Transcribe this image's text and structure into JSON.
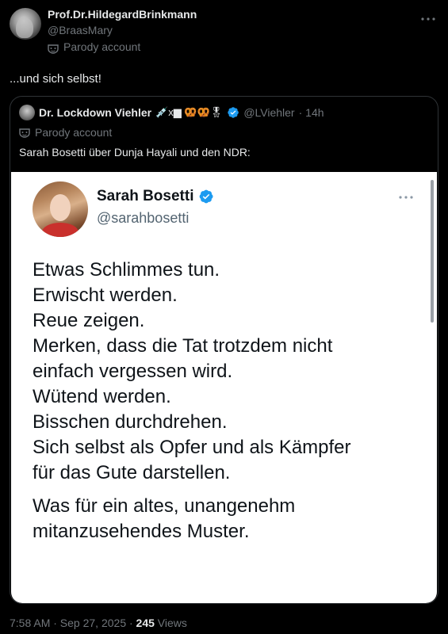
{
  "post": {
    "author_name": "Prof.Dr.HildegardBrinkmann",
    "author_handle": "@BraasMary",
    "parody_label": "Parody account",
    "text": "...und sich selbst!",
    "timestamp": "7:58 AM · Sep 27, 2025 · ",
    "views_count": "245",
    "views_label": " Views"
  },
  "quote": {
    "author_name": "Dr. Lockdown Viehler",
    "author_emojis": "💉x▆ 🥨🥨🎖",
    "author_handle": "@LViehler",
    "time": "· 14h",
    "parody_label": "Parody account",
    "text": "Sarah Bosetti über Dunja Hayali und den NDR:"
  },
  "screenshot": {
    "name": "Sarah Bosetti",
    "handle": "@sarahbosetti",
    "lines": [
      "Etwas Schlimmes tun.",
      "Erwischt werden.",
      "Reue zeigen.",
      "Merken, dass die Tat trotzdem nicht",
      "einfach vergessen wird.",
      "Wütend werden.",
      "Bisschen durchdrehen.",
      "Sich selbst als Opfer und als Kämpfer",
      "für das Gute darstellen."
    ],
    "lines2": [
      "Was für ein altes, unangenehm",
      "mitanzusehendes Muster."
    ]
  },
  "colors": {
    "verified_blue": "#1d9bf0",
    "background": "#000000",
    "muted_text": "#71767b"
  },
  "icons": {
    "more": "more-icon",
    "parody": "mask-icon",
    "verified": "verified-badge-icon"
  }
}
